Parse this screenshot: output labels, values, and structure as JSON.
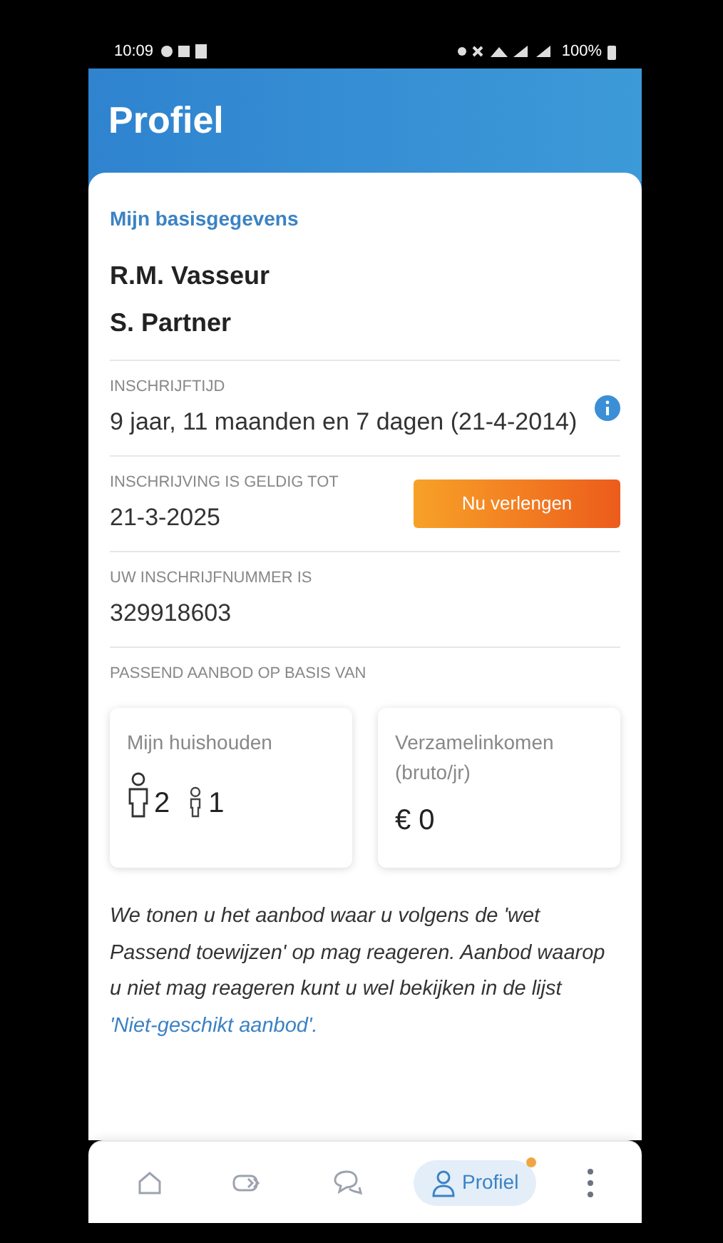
{
  "status_bar": {
    "time": "10:09",
    "battery": "100%"
  },
  "header": {
    "title": "Profiel"
  },
  "section_title": "Mijn basisgegevens",
  "names": [
    "R.M. Vasseur",
    "S. Partner"
  ],
  "fields": [
    {
      "kind": "info",
      "label": "INSCHRIJFTIJD",
      "value": "9 jaar, 11 maanden en 7 dagen (21-4-2014)"
    },
    {
      "kind": "action",
      "label": "INSCHRIJVING IS GELDIG TOT",
      "value": "21-3-2025",
      "button": "Nu verlengen"
    },
    {
      "kind": "plain",
      "label": "UW INSCHRIJFNUMMER IS",
      "value": "329918603"
    }
  ],
  "offer_label": "PASSEND AANBOD OP BASIS VAN",
  "household": {
    "title": "Mijn huishouden",
    "adults": "2",
    "children": "1"
  },
  "income": {
    "title": "Verzamelinkomen (bruto/jr)",
    "value": "€ 0"
  },
  "note": {
    "text": "We tonen u het aanbod waar u volgens de 'wet Passend toewijzen' op mag reageren. Aanbod waarop u niet mag reageren kunt u wel bekijken in de lijst",
    "link": "'Niet-geschikt aanbod'."
  },
  "nav": [
    {
      "kind": "home",
      "selected": false
    },
    {
      "kind": "tickets",
      "selected": false
    },
    {
      "kind": "chat",
      "selected": false
    },
    {
      "kind": "profile",
      "label": "Profiel",
      "selected": true,
      "badge": true
    },
    {
      "kind": "more",
      "selected": false
    }
  ]
}
